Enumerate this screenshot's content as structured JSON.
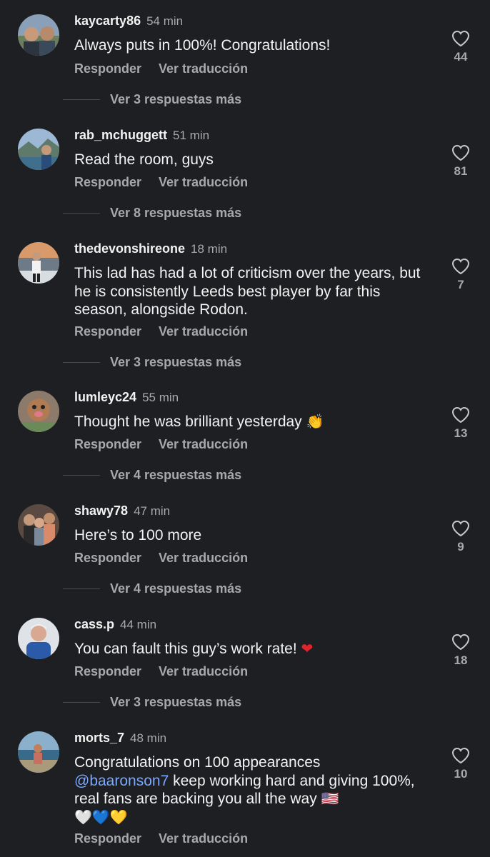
{
  "comments": [
    {
      "username": "kaycarty86",
      "time": "54 min",
      "text": "Always puts in 100%! Congratulations!",
      "likes": "44",
      "reply_label": "Responder",
      "translate_label": "Ver traducción",
      "more_replies": "Ver 3 respuestas más"
    },
    {
      "username": "rab_mchuggett",
      "time": "51 min",
      "text": "Read the room, guys",
      "likes": "81",
      "reply_label": "Responder",
      "translate_label": "Ver traducción",
      "more_replies": "Ver 8 respuestas más"
    },
    {
      "username": "thedevonshireone",
      "time": "18 min",
      "text": "This lad has had a lot of criticism over the years, but he is consistently Leeds best player by far this season, alongside Rodon.",
      "likes": "7",
      "reply_label": "Responder",
      "translate_label": "Ver traducción",
      "more_replies": "Ver 3 respuestas más"
    },
    {
      "username": "lumleyc24",
      "time": "55 min",
      "text": "Thought he was brilliant yesterday",
      "emoji": "👏",
      "likes": "13",
      "reply_label": "Responder",
      "translate_label": "Ver traducción",
      "more_replies": "Ver 4 respuestas más"
    },
    {
      "username": "shawy78",
      "time": "47 min",
      "text": "Here’s to 100 more",
      "likes": "9",
      "reply_label": "Responder",
      "translate_label": "Ver traducción",
      "more_replies": "Ver 4 respuestas más"
    },
    {
      "username": "cass.p",
      "time": "44 min",
      "text": "You can fault this guy’s work rate!",
      "emoji": "❤",
      "likes": "18",
      "reply_label": "Responder",
      "translate_label": "Ver traducción",
      "more_replies": "Ver 3 respuestas más"
    },
    {
      "username": "morts_7",
      "time": "48 min",
      "text_before": "Congratulations on 100 appearances ",
      "mention": "@baaronson7",
      "text_after": " keep working hard and giving 100%, real fans are backing you all the way",
      "emoji_flag": "🇺🇸",
      "emoji_hearts": "🤍💙💛",
      "likes": "10",
      "reply_label": "Responder",
      "translate_label": "Ver traducción"
    }
  ],
  "icons": {
    "like": "heart-outline-icon"
  },
  "colors": {
    "background": "#1e1f22",
    "text": "#f2f2f2",
    "muted": "#a8a8ad",
    "mention": "#7aa7ff"
  }
}
